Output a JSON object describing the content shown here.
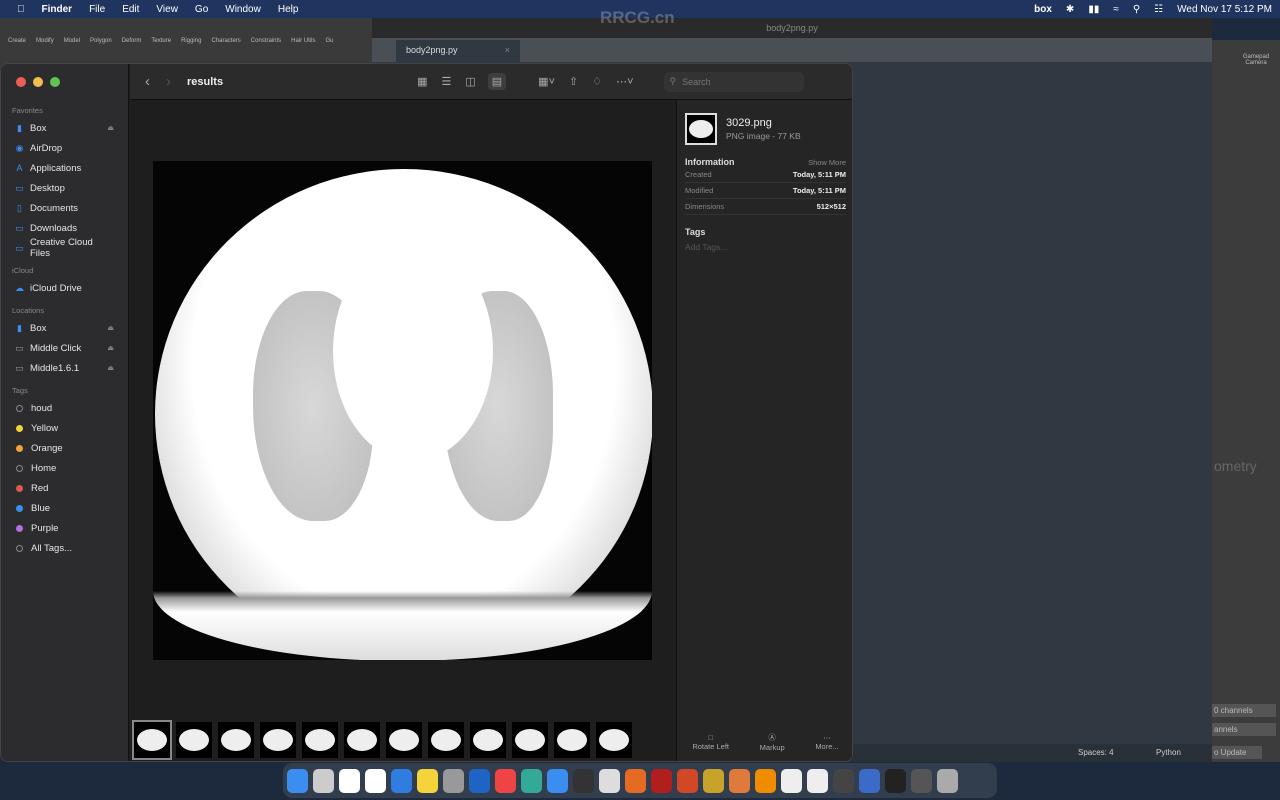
{
  "menubar": {
    "app": "Finder",
    "items": [
      "File",
      "Edit",
      "View",
      "Go",
      "Window",
      "Help"
    ],
    "status_icons": [
      "box",
      "bluetooth-icon",
      "battery-icon",
      "wifi-icon",
      "search-icon",
      "control-center-icon"
    ],
    "box_label": "box",
    "clock": "Wed Nov 17  5:12 PM"
  },
  "maya": {
    "shelf_tabs": [
      "Create",
      "Modify",
      "Model",
      "Polygon",
      "Deform",
      "Texture",
      "Rigging",
      "Characters",
      "Constraints",
      "Hair Utils",
      "Gu"
    ]
  },
  "sublime": {
    "title": "body2png.py",
    "tab": "body2png.py",
    "status_spaces": "Spaces: 4",
    "status_syntax": "Python"
  },
  "houdini": {
    "gamepad": "Gamepad Camera",
    "geometry": "ometry",
    "channels1": "0 channels",
    "channels2": "annels",
    "update": "o Update"
  },
  "finder": {
    "title": "results",
    "search_placeholder": "Search",
    "sidebar": {
      "favorites_label": "Favorites",
      "favorites": [
        {
          "label": "Box",
          "icon": "file-icon",
          "eject": true
        },
        {
          "label": "AirDrop",
          "icon": "airdrop-icon"
        },
        {
          "label": "Applications",
          "icon": "applications-icon"
        },
        {
          "label": "Desktop",
          "icon": "desktop-icon"
        },
        {
          "label": "Documents",
          "icon": "document-icon"
        },
        {
          "label": "Downloads",
          "icon": "folder-icon"
        },
        {
          "label": "Creative Cloud Files",
          "icon": "folder-icon"
        }
      ],
      "icloud_label": "iCloud",
      "icloud": [
        {
          "label": "iCloud Drive",
          "icon": "cloud-icon"
        }
      ],
      "locations_label": "Locations",
      "locations": [
        {
          "label": "Box",
          "icon": "file-icon"
        },
        {
          "label": "Middle Click",
          "icon": "drive-icon"
        },
        {
          "label": "Middle1.6.1",
          "icon": "drive-icon"
        }
      ],
      "tags_label": "Tags",
      "tags": [
        {
          "label": "houd",
          "color": ""
        },
        {
          "label": "Yellow",
          "color": "#f5d33b"
        },
        {
          "label": "Orange",
          "color": "#f2a33a"
        },
        {
          "label": "Home",
          "color": ""
        },
        {
          "label": "Red",
          "color": "#e2574f"
        },
        {
          "label": "Blue",
          "color": "#3b8ef0"
        },
        {
          "label": "Purple",
          "color": "#b76ee0"
        },
        {
          "label": "All Tags...",
          "color": ""
        }
      ]
    },
    "info": {
      "filename": "3029.png",
      "kind": "PNG image - 77 KB",
      "section": "Information",
      "show_more": "Show More",
      "rows": [
        {
          "k": "Created",
          "v": "Today, 5:11 PM"
        },
        {
          "k": "Modified",
          "v": "Today, 5:11 PM"
        },
        {
          "k": "Dimensions",
          "v": "512×512"
        }
      ],
      "tags_title": "Tags",
      "add_tags": "Add Tags..."
    },
    "actions": [
      {
        "label": "Rotate Left"
      },
      {
        "label": "Markup"
      },
      {
        "label": "More..."
      }
    ],
    "thumbnail_count": 12
  },
  "watermark": "RRCG.cn"
}
